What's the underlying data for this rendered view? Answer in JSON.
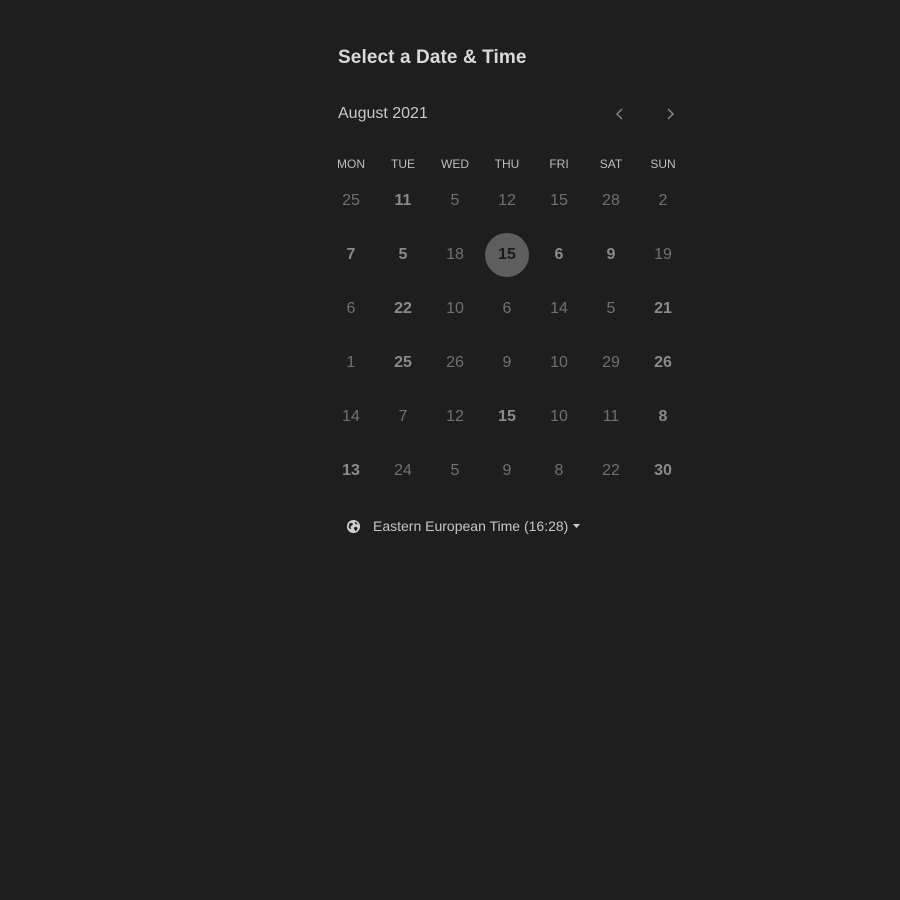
{
  "header": {
    "title": "Select a Date & Time"
  },
  "calendar": {
    "month_label": "August 2021",
    "prev_icon": "chevron-left-icon",
    "next_icon": "chevron-right-icon",
    "weekdays": [
      "MON",
      "TUE",
      "WED",
      "THU",
      "FRI",
      "SAT",
      "SUN"
    ],
    "weeks": [
      [
        {
          "label": "25",
          "available": false
        },
        {
          "label": "11",
          "available": true
        },
        {
          "label": "5",
          "available": false
        },
        {
          "label": "12",
          "available": false
        },
        {
          "label": "15",
          "available": false
        },
        {
          "label": "28",
          "available": false
        },
        {
          "label": "2",
          "available": false
        }
      ],
      [
        {
          "label": "7",
          "available": true
        },
        {
          "label": "5",
          "available": true
        },
        {
          "label": "18",
          "available": false
        },
        {
          "label": "15",
          "available": true,
          "selected": true
        },
        {
          "label": "6",
          "available": true
        },
        {
          "label": "9",
          "available": true
        },
        {
          "label": "19",
          "available": false
        }
      ],
      [
        {
          "label": "6",
          "available": false
        },
        {
          "label": "22",
          "available": true
        },
        {
          "label": "10",
          "available": false
        },
        {
          "label": "6",
          "available": false
        },
        {
          "label": "14",
          "available": false
        },
        {
          "label": "5",
          "available": false
        },
        {
          "label": "21",
          "available": true
        }
      ],
      [
        {
          "label": "1",
          "available": false
        },
        {
          "label": "25",
          "available": true
        },
        {
          "label": "26",
          "available": false
        },
        {
          "label": "9",
          "available": false
        },
        {
          "label": "10",
          "available": false
        },
        {
          "label": "29",
          "available": false
        },
        {
          "label": "26",
          "available": true
        }
      ],
      [
        {
          "label": "14",
          "available": false
        },
        {
          "label": "7",
          "available": false
        },
        {
          "label": "12",
          "available": false
        },
        {
          "label": "15",
          "available": true
        },
        {
          "label": "10",
          "available": false
        },
        {
          "label": "11",
          "available": false
        },
        {
          "label": "8",
          "available": true
        }
      ],
      [
        {
          "label": "13",
          "available": true
        },
        {
          "label": "24",
          "available": false
        },
        {
          "label": "5",
          "available": false
        },
        {
          "label": "9",
          "available": false
        },
        {
          "label": "8",
          "available": false
        },
        {
          "label": "22",
          "available": false
        },
        {
          "label": "30",
          "available": true
        }
      ]
    ]
  },
  "timezone": {
    "icon": "globe-icon",
    "label": "Eastern European Time (16:28)",
    "dropdown_icon": "caret-down-icon"
  },
  "colors": {
    "background": "#1e1e1e",
    "selected_day_bg": "#5e5e5e",
    "available_day": "#8a8a8a",
    "unavailable_day": "#707070"
  }
}
